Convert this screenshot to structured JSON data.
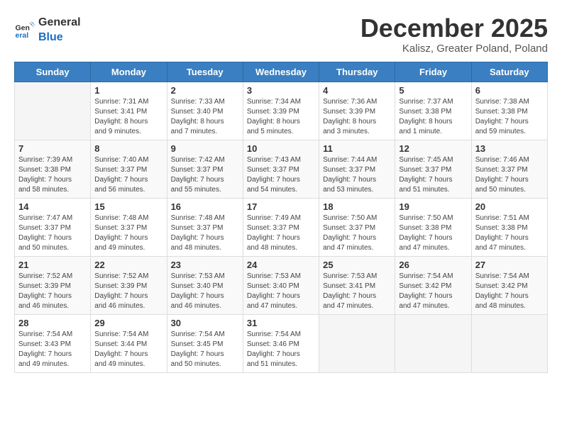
{
  "header": {
    "logo_general": "General",
    "logo_blue": "Blue",
    "month_title": "December 2025",
    "location": "Kalisz, Greater Poland, Poland"
  },
  "weekdays": [
    "Sunday",
    "Monday",
    "Tuesday",
    "Wednesday",
    "Thursday",
    "Friday",
    "Saturday"
  ],
  "weeks": [
    [
      {
        "day": "",
        "info": ""
      },
      {
        "day": "1",
        "info": "Sunrise: 7:31 AM\nSunset: 3:41 PM\nDaylight: 8 hours\nand 9 minutes."
      },
      {
        "day": "2",
        "info": "Sunrise: 7:33 AM\nSunset: 3:40 PM\nDaylight: 8 hours\nand 7 minutes."
      },
      {
        "day": "3",
        "info": "Sunrise: 7:34 AM\nSunset: 3:39 PM\nDaylight: 8 hours\nand 5 minutes."
      },
      {
        "day": "4",
        "info": "Sunrise: 7:36 AM\nSunset: 3:39 PM\nDaylight: 8 hours\nand 3 minutes."
      },
      {
        "day": "5",
        "info": "Sunrise: 7:37 AM\nSunset: 3:38 PM\nDaylight: 8 hours\nand 1 minute."
      },
      {
        "day": "6",
        "info": "Sunrise: 7:38 AM\nSunset: 3:38 PM\nDaylight: 7 hours\nand 59 minutes."
      }
    ],
    [
      {
        "day": "7",
        "info": "Sunrise: 7:39 AM\nSunset: 3:38 PM\nDaylight: 7 hours\nand 58 minutes."
      },
      {
        "day": "8",
        "info": "Sunrise: 7:40 AM\nSunset: 3:37 PM\nDaylight: 7 hours\nand 56 minutes."
      },
      {
        "day": "9",
        "info": "Sunrise: 7:42 AM\nSunset: 3:37 PM\nDaylight: 7 hours\nand 55 minutes."
      },
      {
        "day": "10",
        "info": "Sunrise: 7:43 AM\nSunset: 3:37 PM\nDaylight: 7 hours\nand 54 minutes."
      },
      {
        "day": "11",
        "info": "Sunrise: 7:44 AM\nSunset: 3:37 PM\nDaylight: 7 hours\nand 53 minutes."
      },
      {
        "day": "12",
        "info": "Sunrise: 7:45 AM\nSunset: 3:37 PM\nDaylight: 7 hours\nand 51 minutes."
      },
      {
        "day": "13",
        "info": "Sunrise: 7:46 AM\nSunset: 3:37 PM\nDaylight: 7 hours\nand 50 minutes."
      }
    ],
    [
      {
        "day": "14",
        "info": "Sunrise: 7:47 AM\nSunset: 3:37 PM\nDaylight: 7 hours\nand 50 minutes."
      },
      {
        "day": "15",
        "info": "Sunrise: 7:48 AM\nSunset: 3:37 PM\nDaylight: 7 hours\nand 49 minutes."
      },
      {
        "day": "16",
        "info": "Sunrise: 7:48 AM\nSunset: 3:37 PM\nDaylight: 7 hours\nand 48 minutes."
      },
      {
        "day": "17",
        "info": "Sunrise: 7:49 AM\nSunset: 3:37 PM\nDaylight: 7 hours\nand 48 minutes."
      },
      {
        "day": "18",
        "info": "Sunrise: 7:50 AM\nSunset: 3:37 PM\nDaylight: 7 hours\nand 47 minutes."
      },
      {
        "day": "19",
        "info": "Sunrise: 7:50 AM\nSunset: 3:38 PM\nDaylight: 7 hours\nand 47 minutes."
      },
      {
        "day": "20",
        "info": "Sunrise: 7:51 AM\nSunset: 3:38 PM\nDaylight: 7 hours\nand 47 minutes."
      }
    ],
    [
      {
        "day": "21",
        "info": "Sunrise: 7:52 AM\nSunset: 3:39 PM\nDaylight: 7 hours\nand 46 minutes."
      },
      {
        "day": "22",
        "info": "Sunrise: 7:52 AM\nSunset: 3:39 PM\nDaylight: 7 hours\nand 46 minutes."
      },
      {
        "day": "23",
        "info": "Sunrise: 7:53 AM\nSunset: 3:40 PM\nDaylight: 7 hours\nand 46 minutes."
      },
      {
        "day": "24",
        "info": "Sunrise: 7:53 AM\nSunset: 3:40 PM\nDaylight: 7 hours\nand 47 minutes."
      },
      {
        "day": "25",
        "info": "Sunrise: 7:53 AM\nSunset: 3:41 PM\nDaylight: 7 hours\nand 47 minutes."
      },
      {
        "day": "26",
        "info": "Sunrise: 7:54 AM\nSunset: 3:42 PM\nDaylight: 7 hours\nand 47 minutes."
      },
      {
        "day": "27",
        "info": "Sunrise: 7:54 AM\nSunset: 3:42 PM\nDaylight: 7 hours\nand 48 minutes."
      }
    ],
    [
      {
        "day": "28",
        "info": "Sunrise: 7:54 AM\nSunset: 3:43 PM\nDaylight: 7 hours\nand 49 minutes."
      },
      {
        "day": "29",
        "info": "Sunrise: 7:54 AM\nSunset: 3:44 PM\nDaylight: 7 hours\nand 49 minutes."
      },
      {
        "day": "30",
        "info": "Sunrise: 7:54 AM\nSunset: 3:45 PM\nDaylight: 7 hours\nand 50 minutes."
      },
      {
        "day": "31",
        "info": "Sunrise: 7:54 AM\nSunset: 3:46 PM\nDaylight: 7 hours\nand 51 minutes."
      },
      {
        "day": "",
        "info": ""
      },
      {
        "day": "",
        "info": ""
      },
      {
        "day": "",
        "info": ""
      }
    ]
  ]
}
